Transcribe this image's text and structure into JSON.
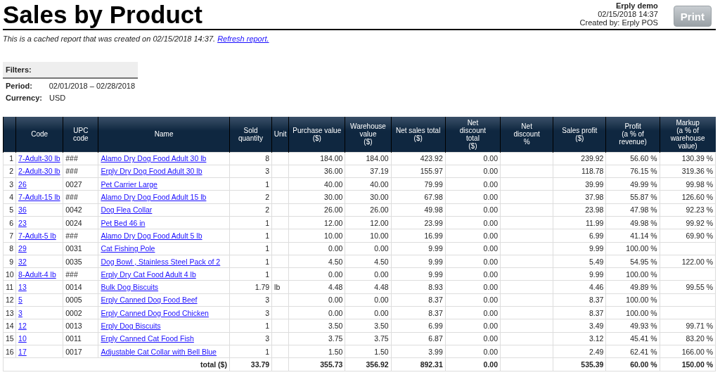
{
  "title": "Sales by Product",
  "header_info": {
    "company": "Erply demo",
    "datetime": "02/15/2018 14:37",
    "created_by": "Created by: Erply POS"
  },
  "print_button": "Print",
  "cache_notice": {
    "text": "This is a cached report that was created on 02/15/2018 14:37.",
    "link": "Refresh report."
  },
  "filters": {
    "heading": "Filters:",
    "items": [
      {
        "label": "Period:",
        "value": "02/01/2018 – 02/28/2018"
      },
      {
        "label": "Currency:",
        "value": "USD"
      }
    ]
  },
  "table": {
    "columns": [
      {
        "label": "Code",
        "kind": "link"
      },
      {
        "label": "UPC code",
        "kind": "text"
      },
      {
        "label": "Name",
        "kind": "link"
      },
      {
        "label": "Sold quantity",
        "kind": "number"
      },
      {
        "label": "Unit",
        "kind": "text"
      },
      {
        "label": "Purchase value\n($)",
        "kind": "number"
      },
      {
        "label": "Warehouse\nvalue\n($)",
        "kind": "number"
      },
      {
        "label": "Net sales total\n($)",
        "kind": "number"
      },
      {
        "label": "Net\ndiscount\ntotal\n($)",
        "kind": "number"
      },
      {
        "label": "Net\ndiscount\n%",
        "kind": "number"
      },
      {
        "label": "Sales profit\n($)",
        "kind": "number"
      },
      {
        "label": "Profit\n(a % of\nrevenue)",
        "kind": "number"
      },
      {
        "label": "Markup\n(a % of\nwarehouse\nvalue)",
        "kind": "number"
      }
    ],
    "rows": [
      {
        "number": "1",
        "cells": [
          "7-Adult-30 lb",
          "###",
          "Alamo Dry Dog Food Adult 30 lb",
          "8",
          null,
          "184.00",
          "184.00",
          "423.92",
          "0.00",
          null,
          "239.92",
          "56.60 %",
          "130.39 %"
        ]
      },
      {
        "number": "2",
        "cells": [
          "2-Adult-30 lb",
          "###",
          "Erply Dry Dog Food Adult 30 lb",
          "3",
          null,
          "36.00",
          "37.19",
          "155.97",
          "0.00",
          null,
          "118.78",
          "76.15 %",
          "319.36 %"
        ]
      },
      {
        "number": "3",
        "cells": [
          "26",
          "0027",
          "Pet Carrier Large",
          "1",
          null,
          "40.00",
          "40.00",
          "79.99",
          "0.00",
          null,
          "39.99",
          "49.99 %",
          "99.98 %"
        ]
      },
      {
        "number": "4",
        "cells": [
          "7-Adult-15 lb",
          "###",
          "Alamo Dry Dog Food Adult 15 lb",
          "2",
          null,
          "30.00",
          "30.00",
          "67.98",
          "0.00",
          null,
          "37.98",
          "55.87 %",
          "126.60 %"
        ]
      },
      {
        "number": "5",
        "cells": [
          "36",
          "0042",
          "Dog Flea Collar",
          "2",
          null,
          "26.00",
          "26.00",
          "49.98",
          "0.00",
          null,
          "23.98",
          "47.98 %",
          "92.23 %"
        ]
      },
      {
        "number": "6",
        "cells": [
          "23",
          "0024",
          "Pet Bed 46 in",
          "1",
          null,
          "12.00",
          "12.00",
          "23.99",
          "0.00",
          null,
          "11.99",
          "49.98 %",
          "99.92 %"
        ]
      },
      {
        "number": "7",
        "cells": [
          "7-Adult-5 lb",
          "###",
          "Alamo Dry Dog Food Adult 5 lb",
          "1",
          null,
          "10.00",
          "10.00",
          "16.99",
          "0.00",
          null,
          "6.99",
          "41.14 %",
          "69.90 %"
        ]
      },
      {
        "number": "8",
        "cells": [
          "29",
          "0031",
          "Cat Fishing Pole",
          "1",
          null,
          "0.00",
          "0.00",
          "9.99",
          "0.00",
          null,
          "9.99",
          "100.00 %",
          null
        ]
      },
      {
        "number": "9",
        "cells": [
          "32",
          "0035",
          "Dog Bowl , Stainless Steel Pack of 2",
          "1",
          null,
          "4.50",
          "4.50",
          "9.99",
          "0.00",
          null,
          "5.49",
          "54.95 %",
          "122.00 %"
        ]
      },
      {
        "number": "10",
        "cells": [
          "8-Adult-4 lb",
          "###",
          "Erply Dry Cat Food Adult 4 lb",
          "1",
          null,
          "0.00",
          "0.00",
          "9.99",
          "0.00",
          null,
          "9.99",
          "100.00 %",
          null
        ]
      },
      {
        "number": "11",
        "cells": [
          "13",
          "0014",
          "Bulk Dog Biscuits",
          "1.79",
          "lb",
          "4.48",
          "4.48",
          "8.93",
          "0.00",
          null,
          "4.46",
          "49.89 %",
          "99.55 %"
        ]
      },
      {
        "number": "12",
        "cells": [
          "5",
          "0005",
          "Erply Canned Dog Food Beef",
          "3",
          null,
          "0.00",
          "0.00",
          "8.37",
          "0.00",
          null,
          "8.37",
          "100.00 %",
          null
        ]
      },
      {
        "number": "13",
        "cells": [
          "3",
          "0002",
          "Erply Canned Dog Food Chicken",
          "3",
          null,
          "0.00",
          "0.00",
          "8.37",
          "0.00",
          null,
          "8.37",
          "100.00 %",
          null
        ]
      },
      {
        "number": "14",
        "cells": [
          "12",
          "0013",
          "Erply Dog Biscuits",
          "1",
          null,
          "3.50",
          "3.50",
          "6.99",
          "0.00",
          null,
          "3.49",
          "49.93 %",
          "99.71 %"
        ]
      },
      {
        "number": "15",
        "cells": [
          "10",
          "0011",
          "Erply Canned Cat Food Fish",
          "3",
          null,
          "3.75",
          "3.75",
          "6.87",
          "0.00",
          null,
          "3.12",
          "45.41 %",
          "83.20 %"
        ]
      },
      {
        "number": "16",
        "cells": [
          "17",
          "0017",
          "Adjustable Cat Collar with Bell Blue",
          "1",
          null,
          "1.50",
          "1.50",
          "3.99",
          "0.00",
          null,
          "2.49",
          "62.41 %",
          "166.00 %"
        ]
      }
    ],
    "total": {
      "label": "total ($)",
      "cells": [
        "33.79",
        null,
        "355.73",
        "356.92",
        "892.31",
        "0.00",
        null,
        "535.39",
        "60.00 %",
        "150.00 %"
      ]
    }
  }
}
